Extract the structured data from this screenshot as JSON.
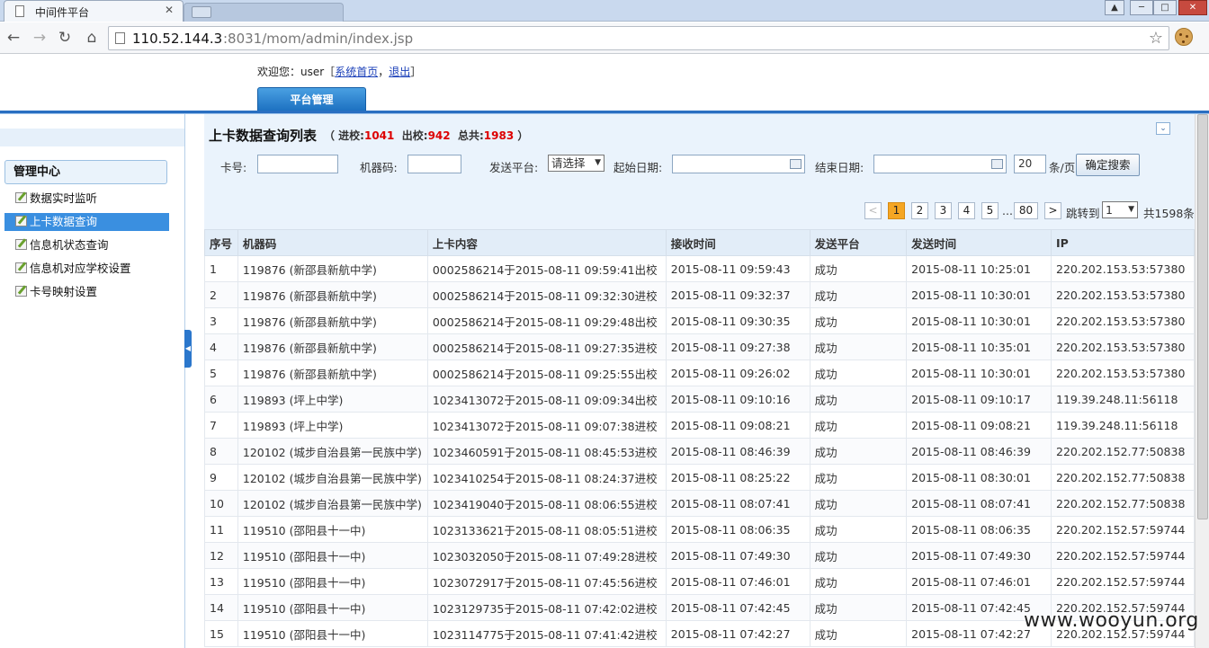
{
  "browser": {
    "tab_title": "中间件平台",
    "tab_close": "✕",
    "url_host": "110.52.144.3",
    "url_rest": ":8031/mom/admin/index.jsp",
    "win_user": "▲",
    "win_min": "─",
    "win_max": "□",
    "win_close": "✕",
    "back_icon": "←",
    "forward_icon": "→",
    "reload_icon": "↻",
    "home_icon": "⌂",
    "star_icon": "☆"
  },
  "header": {
    "welcome_prefix": "欢迎您：user［",
    "home_link": "系统首页",
    "sep": "，",
    "logout_link": "退出",
    "welcome_suffix": "］",
    "main_tab": "平台管理"
  },
  "sidebar": {
    "section_title": "管理中心",
    "items": [
      {
        "label": "数据实时监听"
      },
      {
        "label": "上卡数据查询"
      },
      {
        "label": "信息机状态查询"
      },
      {
        "label": "信息机对应学校设置"
      },
      {
        "label": "卡号映射设置"
      }
    ],
    "collapse_icon": "◀"
  },
  "content": {
    "heading": "上卡数据查询列表",
    "stats_in_label": "（ 进校:",
    "stats_in": "1041",
    "stats_out_label": "出校:",
    "stats_out": "942",
    "stats_total_label": "总共:",
    "stats_total": "1983",
    "stats_close": "）",
    "toggle_icon": "⌄"
  },
  "search": {
    "card_label": "卡号:",
    "card_value": "",
    "machine_label": "机器码:",
    "machine_value": "",
    "platform_label": "发送平台:",
    "platform_value": "请选择",
    "start_label": "起始日期:",
    "start_value": "",
    "end_label": "结束日期:",
    "end_value": "",
    "page_size": "20",
    "page_size_unit": "条/页",
    "search_button": "确定搜索"
  },
  "pager": {
    "prev": "<",
    "pages": [
      "1",
      "2",
      "3",
      "4",
      "5"
    ],
    "ellipsis": "...",
    "last": "80",
    "next": ">",
    "jump_label": "跳转到",
    "jump_value": "1",
    "total": "共1598条"
  },
  "table": {
    "headers": [
      "序号",
      "机器码",
      "上卡内容",
      "接收时间",
      "发送平台",
      "发送时间",
      "IP"
    ],
    "rows": [
      [
        "1",
        "119876 (新邵县新航中学)",
        "0002586214于2015-08-11 09:59:41出校",
        "2015-08-11 09:59:43",
        "成功",
        "2015-08-11 10:25:01",
        "220.202.153.53:57380"
      ],
      [
        "2",
        "119876 (新邵县新航中学)",
        "0002586214于2015-08-11 09:32:30进校",
        "2015-08-11 09:32:37",
        "成功",
        "2015-08-11 10:30:01",
        "220.202.153.53:57380"
      ],
      [
        "3",
        "119876 (新邵县新航中学)",
        "0002586214于2015-08-11 09:29:48出校",
        "2015-08-11 09:30:35",
        "成功",
        "2015-08-11 10:30:01",
        "220.202.153.53:57380"
      ],
      [
        "4",
        "119876 (新邵县新航中学)",
        "0002586214于2015-08-11 09:27:35进校",
        "2015-08-11 09:27:38",
        "成功",
        "2015-08-11 10:35:01",
        "220.202.153.53:57380"
      ],
      [
        "5",
        "119876 (新邵县新航中学)",
        "0002586214于2015-08-11 09:25:55出校",
        "2015-08-11 09:26:02",
        "成功",
        "2015-08-11 10:30:01",
        "220.202.153.53:57380"
      ],
      [
        "6",
        "119893 (坪上中学)",
        "1023413072于2015-08-11 09:09:34出校",
        "2015-08-11 09:10:16",
        "成功",
        "2015-08-11 09:10:17",
        "119.39.248.11:56118"
      ],
      [
        "7",
        "119893 (坪上中学)",
        "1023413072于2015-08-11 09:07:38进校",
        "2015-08-11 09:08:21",
        "成功",
        "2015-08-11 09:08:21",
        "119.39.248.11:56118"
      ],
      [
        "8",
        "120102 (城步自治县第一民族中学)",
        "1023460591于2015-08-11 08:45:53进校",
        "2015-08-11 08:46:39",
        "成功",
        "2015-08-11 08:46:39",
        "220.202.152.77:50838"
      ],
      [
        "9",
        "120102 (城步自治县第一民族中学)",
        "1023410254于2015-08-11 08:24:37进校",
        "2015-08-11 08:25:22",
        "成功",
        "2015-08-11 08:30:01",
        "220.202.152.77:50838"
      ],
      [
        "10",
        "120102 (城步自治县第一民族中学)",
        "1023419040于2015-08-11 08:06:55进校",
        "2015-08-11 08:07:41",
        "成功",
        "2015-08-11 08:07:41",
        "220.202.152.77:50838"
      ],
      [
        "11",
        "119510 (邵阳县十一中)",
        "1023133621于2015-08-11 08:05:51进校",
        "2015-08-11 08:06:35",
        "成功",
        "2015-08-11 08:06:35",
        "220.202.152.57:59744"
      ],
      [
        "12",
        "119510 (邵阳县十一中)",
        "1023032050于2015-08-11 07:49:28进校",
        "2015-08-11 07:49:30",
        "成功",
        "2015-08-11 07:49:30",
        "220.202.152.57:59744"
      ],
      [
        "13",
        "119510 (邵阳县十一中)",
        "1023072917于2015-08-11 07:45:56进校",
        "2015-08-11 07:46:01",
        "成功",
        "2015-08-11 07:46:01",
        "220.202.152.57:59744"
      ],
      [
        "14",
        "119510 (邵阳县十一中)",
        "1023129735于2015-08-11 07:42:02进校",
        "2015-08-11 07:42:45",
        "成功",
        "2015-08-11 07:42:45",
        "220.202.152.57:59744"
      ],
      [
        "15",
        "119510 (邵阳县十一中)",
        "1023114775于2015-08-11 07:41:42进校",
        "2015-08-11 07:42:27",
        "成功",
        "2015-08-11 07:42:27",
        "220.202.152.57:59744"
      ]
    ]
  },
  "watermark": "www.wooyun.org"
}
